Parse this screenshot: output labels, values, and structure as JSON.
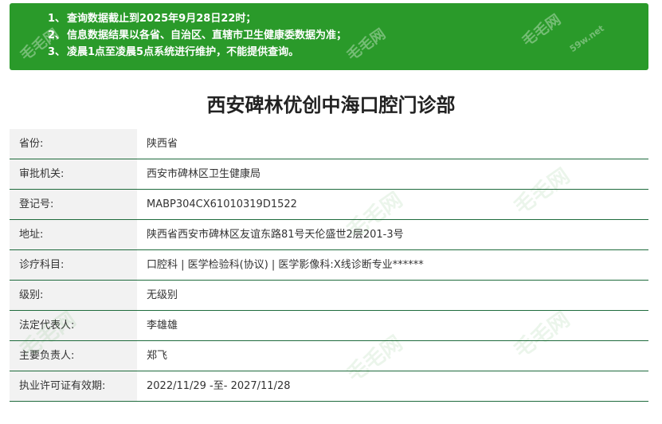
{
  "notice": {
    "lines": [
      {
        "num": "1、",
        "text": "查询数据截止到2025年9月28日22时；"
      },
      {
        "num": "2、",
        "text": "信息数据结果以各省、自治区、直辖市卫生健康委数据为准；"
      },
      {
        "num": "3、",
        "text": "凌晨1点至凌晨5点系统进行维护，不能提供查询。"
      }
    ]
  },
  "watermark": {
    "brand": "毛毛网",
    "site": "59w.net"
  },
  "page_title": "西安碑林优创中海口腔门诊部",
  "rows": [
    {
      "label": "省份:",
      "value": "陕西省"
    },
    {
      "label": "审批机关:",
      "value": "西安市碑林区卫生健康局"
    },
    {
      "label": "登记号:",
      "value": "MABP304CX61010319D1522"
    },
    {
      "label": "地址:",
      "value": "陕西省西安市碑林区友谊东路81号天伦盛世2层201-3号"
    },
    {
      "label": "诊疗科目:",
      "value": "口腔科 | 医学检验科(协议) | 医学影像科:X线诊断专业******"
    },
    {
      "label": "级别:",
      "value": "无级别"
    },
    {
      "label": "法定代表人:",
      "value": "李雄雄"
    },
    {
      "label": "主要负责人:",
      "value": "郑飞"
    },
    {
      "label": "执业许可证有效期:",
      "value": "2022/11/29 -至- 2027/11/28"
    }
  ]
}
